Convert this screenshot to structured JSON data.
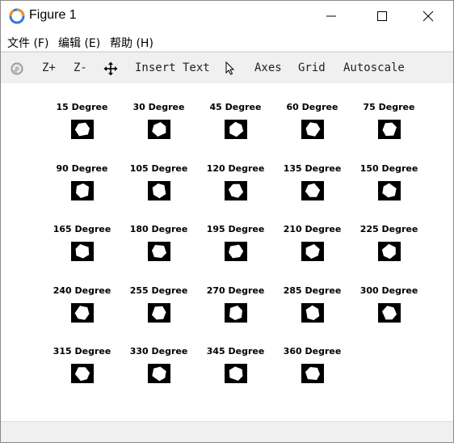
{
  "window": {
    "title": "Figure 1"
  },
  "menu": {
    "items": [
      {
        "label": "文件 (F)"
      },
      {
        "label": "编辑 (E)"
      },
      {
        "label": "帮助 (H)"
      }
    ]
  },
  "toolbar": {
    "zoom_in": "Z+",
    "zoom_out": "Z-",
    "insert_text": "Insert Text",
    "axes": "Axes",
    "grid": "Grid",
    "autoscale": "Autoscale"
  },
  "figure": {
    "subplots": [
      {
        "title": "15 Degree",
        "angle": 15
      },
      {
        "title": "30 Degree",
        "angle": 30
      },
      {
        "title": "45 Degree",
        "angle": 45
      },
      {
        "title": "60 Degree",
        "angle": 60
      },
      {
        "title": "75 Degree",
        "angle": 75
      },
      {
        "title": "90 Degree",
        "angle": 90
      },
      {
        "title": "105 Degree",
        "angle": 105
      },
      {
        "title": "120 Degree",
        "angle": 120
      },
      {
        "title": "135 Degree",
        "angle": 135
      },
      {
        "title": "150 Degree",
        "angle": 150
      },
      {
        "title": "165 Degree",
        "angle": 165
      },
      {
        "title": "180 Degree",
        "angle": 180
      },
      {
        "title": "195 Degree",
        "angle": 195
      },
      {
        "title": "210 Degree",
        "angle": 210
      },
      {
        "title": "225 Degree",
        "angle": 225
      },
      {
        "title": "240 Degree",
        "angle": 240
      },
      {
        "title": "255 Degree",
        "angle": 255
      },
      {
        "title": "270 Degree",
        "angle": 270
      },
      {
        "title": "285 Degree",
        "angle": 285
      },
      {
        "title": "300 Degree",
        "angle": 300
      },
      {
        "title": "315 Degree",
        "angle": 315
      },
      {
        "title": "330 Degree",
        "angle": 330
      },
      {
        "title": "345 Degree",
        "angle": 345
      },
      {
        "title": "360 Degree",
        "angle": 360
      }
    ]
  },
  "colors": {
    "toolbar_bg": "#f0f0f0",
    "image_bg": "#000000",
    "shape_fill": "#ffffff",
    "icon_orange": "#f28c28",
    "icon_blue": "#2e7bd6"
  }
}
